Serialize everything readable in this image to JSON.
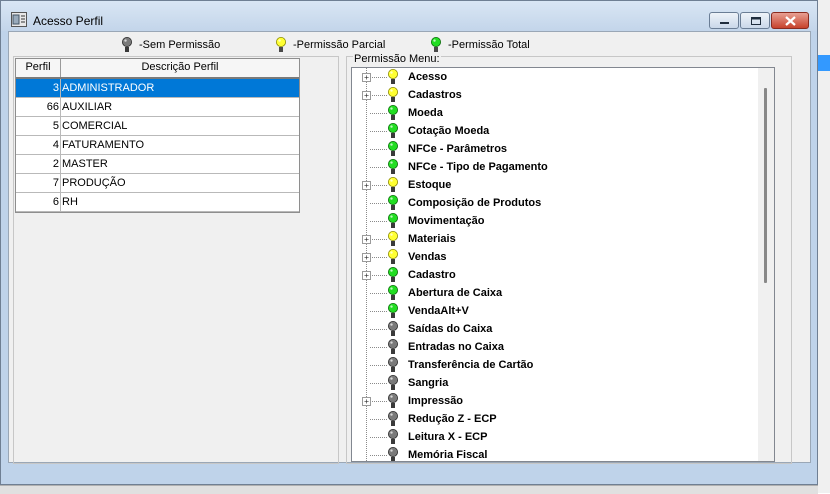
{
  "window": {
    "title": "Acesso Perfil"
  },
  "legend": [
    {
      "label": "-Sem Permissão",
      "icon": "gray-bulb-icon",
      "color": "#7a7a7a"
    },
    {
      "label": "-Permissão Parcial",
      "icon": "yellow-bulb-icon",
      "color": "#ffff33"
    },
    {
      "label": "-Permissão Total",
      "icon": "green-bulb-icon",
      "color": "#22dd22"
    }
  ],
  "profiles": {
    "columns": [
      "Perfil",
      "Descrição Perfil"
    ],
    "rows": [
      {
        "id": "3",
        "description": "ADMINISTRADOR",
        "selected": true
      },
      {
        "id": "66",
        "description": "AUXILIAR"
      },
      {
        "id": "5",
        "description": "COMERCIAL"
      },
      {
        "id": "4",
        "description": "FATURAMENTO"
      },
      {
        "id": "2",
        "description": "MASTER"
      },
      {
        "id": "7",
        "description": "PRODUÇÃO"
      },
      {
        "id": "6",
        "description": "RH"
      }
    ]
  },
  "permissions": {
    "label": "Permissão Menu:",
    "items": [
      {
        "label": "Acesso",
        "status": "partial",
        "expandable": true
      },
      {
        "label": "Cadastros",
        "status": "partial",
        "expandable": true
      },
      {
        "label": "Moeda",
        "status": "total",
        "expandable": false
      },
      {
        "label": "Cotação Moeda",
        "status": "total",
        "expandable": false
      },
      {
        "label": "NFCe - Parâmetros",
        "status": "total",
        "expandable": false
      },
      {
        "label": "NFCe - Tipo de Pagamento",
        "status": "total",
        "expandable": false
      },
      {
        "label": "Estoque",
        "status": "partial",
        "expandable": true
      },
      {
        "label": "Composição de Produtos",
        "status": "total",
        "expandable": false
      },
      {
        "label": "Movimentação",
        "status": "total",
        "expandable": false
      },
      {
        "label": "Materiais",
        "status": "partial",
        "expandable": true
      },
      {
        "label": "Vendas",
        "status": "partial",
        "expandable": true
      },
      {
        "label": "Cadastro",
        "status": "total",
        "expandable": true
      },
      {
        "label": "Abertura de Caixa",
        "status": "total",
        "expandable": false
      },
      {
        "label": "VendaAlt+V",
        "status": "total",
        "expandable": false
      },
      {
        "label": "Saídas do Caixa",
        "status": "none",
        "expandable": false
      },
      {
        "label": "Entradas no Caixa",
        "status": "none",
        "expandable": false
      },
      {
        "label": "Transferência de Cartão",
        "status": "none",
        "expandable": false
      },
      {
        "label": "Sangria",
        "status": "none",
        "expandable": false
      },
      {
        "label": "Impressão",
        "status": "none",
        "expandable": true
      },
      {
        "label": "Redução Z - ECP",
        "status": "none",
        "expandable": false
      },
      {
        "label": "Leitura X - ECP",
        "status": "none",
        "expandable": false
      },
      {
        "label": "Memória Fiscal",
        "status": "none",
        "expandable": false
      }
    ]
  },
  "colors": {
    "selection": "#0078d7",
    "status_none": "#7a7a7a",
    "status_partial": "#ffff33",
    "status_total": "#22dd22"
  }
}
